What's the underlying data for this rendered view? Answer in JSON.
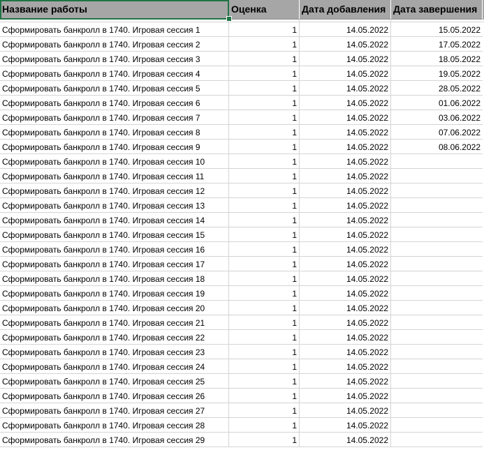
{
  "table": {
    "columns": [
      "Название работы",
      "Оценка",
      "Дата добавления",
      "Дата завершения"
    ],
    "rows": [
      {
        "name": "Сформировать банкролл в 1740. Игровая сессия 1",
        "score": "1",
        "added": "14.05.2022",
        "completed": "15.05.2022"
      },
      {
        "name": "Сформировать банкролл в 1740. Игровая сессия 2",
        "score": "1",
        "added": "14.05.2022",
        "completed": "17.05.2022"
      },
      {
        "name": "Сформировать банкролл в 1740. Игровая сессия 3",
        "score": "1",
        "added": "14.05.2022",
        "completed": "18.05.2022"
      },
      {
        "name": "Сформировать банкролл в 1740. Игровая сессия 4",
        "score": "1",
        "added": "14.05.2022",
        "completed": "19.05.2022"
      },
      {
        "name": "Сформировать банкролл в 1740. Игровая сессия 5",
        "score": "1",
        "added": "14.05.2022",
        "completed": "28.05.2022"
      },
      {
        "name": "Сформировать банкролл в 1740. Игровая сессия 6",
        "score": "1",
        "added": "14.05.2022",
        "completed": "01.06.2022"
      },
      {
        "name": "Сформировать банкролл в 1740. Игровая сессия 7",
        "score": "1",
        "added": "14.05.2022",
        "completed": "03.06.2022"
      },
      {
        "name": "Сформировать банкролл в 1740. Игровая сессия 8",
        "score": "1",
        "added": "14.05.2022",
        "completed": "07.06.2022"
      },
      {
        "name": "Сформировать банкролл в 1740. Игровая сессия 9",
        "score": "1",
        "added": "14.05.2022",
        "completed": "08.06.2022"
      },
      {
        "name": "Сформировать банкролл в 1740. Игровая сессия 10",
        "score": "1",
        "added": "14.05.2022",
        "completed": ""
      },
      {
        "name": "Сформировать банкролл в 1740. Игровая сессия 11",
        "score": "1",
        "added": "14.05.2022",
        "completed": ""
      },
      {
        "name": "Сформировать банкролл в 1740. Игровая сессия 12",
        "score": "1",
        "added": "14.05.2022",
        "completed": ""
      },
      {
        "name": "Сформировать банкролл в 1740. Игровая сессия 13",
        "score": "1",
        "added": "14.05.2022",
        "completed": ""
      },
      {
        "name": "Сформировать банкролл в 1740. Игровая сессия 14",
        "score": "1",
        "added": "14.05.2022",
        "completed": ""
      },
      {
        "name": "Сформировать банкролл в 1740. Игровая сессия 15",
        "score": "1",
        "added": "14.05.2022",
        "completed": ""
      },
      {
        "name": "Сформировать банкролл в 1740. Игровая сессия 16",
        "score": "1",
        "added": "14.05.2022",
        "completed": ""
      },
      {
        "name": "Сформировать банкролл в 1740. Игровая сессия 17",
        "score": "1",
        "added": "14.05.2022",
        "completed": ""
      },
      {
        "name": "Сформировать банкролл в 1740. Игровая сессия 18",
        "score": "1",
        "added": "14.05.2022",
        "completed": ""
      },
      {
        "name": "Сформировать банкролл в 1740. Игровая сессия 19",
        "score": "1",
        "added": "14.05.2022",
        "completed": ""
      },
      {
        "name": "Сформировать банкролл в 1740. Игровая сессия 20",
        "score": "1",
        "added": "14.05.2022",
        "completed": ""
      },
      {
        "name": "Сформировать банкролл в 1740. Игровая сессия 21",
        "score": "1",
        "added": "14.05.2022",
        "completed": ""
      },
      {
        "name": "Сформировать банкролл в 1740. Игровая сессия 22",
        "score": "1",
        "added": "14.05.2022",
        "completed": ""
      },
      {
        "name": "Сформировать банкролл в 1740. Игровая сессия 23",
        "score": "1",
        "added": "14.05.2022",
        "completed": ""
      },
      {
        "name": "Сформировать банкролл в 1740. Игровая сессия 24",
        "score": "1",
        "added": "14.05.2022",
        "completed": ""
      },
      {
        "name": "Сформировать банкролл в 1740. Игровая сессия 25",
        "score": "1",
        "added": "14.05.2022",
        "completed": ""
      },
      {
        "name": "Сформировать банкролл в 1740. Игровая сессия 26",
        "score": "1",
        "added": "14.05.2022",
        "completed": ""
      },
      {
        "name": "Сформировать банкролл в 1740. Игровая сессия 27",
        "score": "1",
        "added": "14.05.2022",
        "completed": ""
      },
      {
        "name": "Сформировать банкролл в 1740. Игровая сессия 28",
        "score": "1",
        "added": "14.05.2022",
        "completed": ""
      },
      {
        "name": "Сформировать банкролл в 1740. Игровая сессия 29",
        "score": "1",
        "added": "14.05.2022",
        "completed": ""
      }
    ]
  },
  "colors": {
    "header_bg": "#a6a6a6",
    "selection": "#217346",
    "gridline": "#d4d4d4"
  }
}
